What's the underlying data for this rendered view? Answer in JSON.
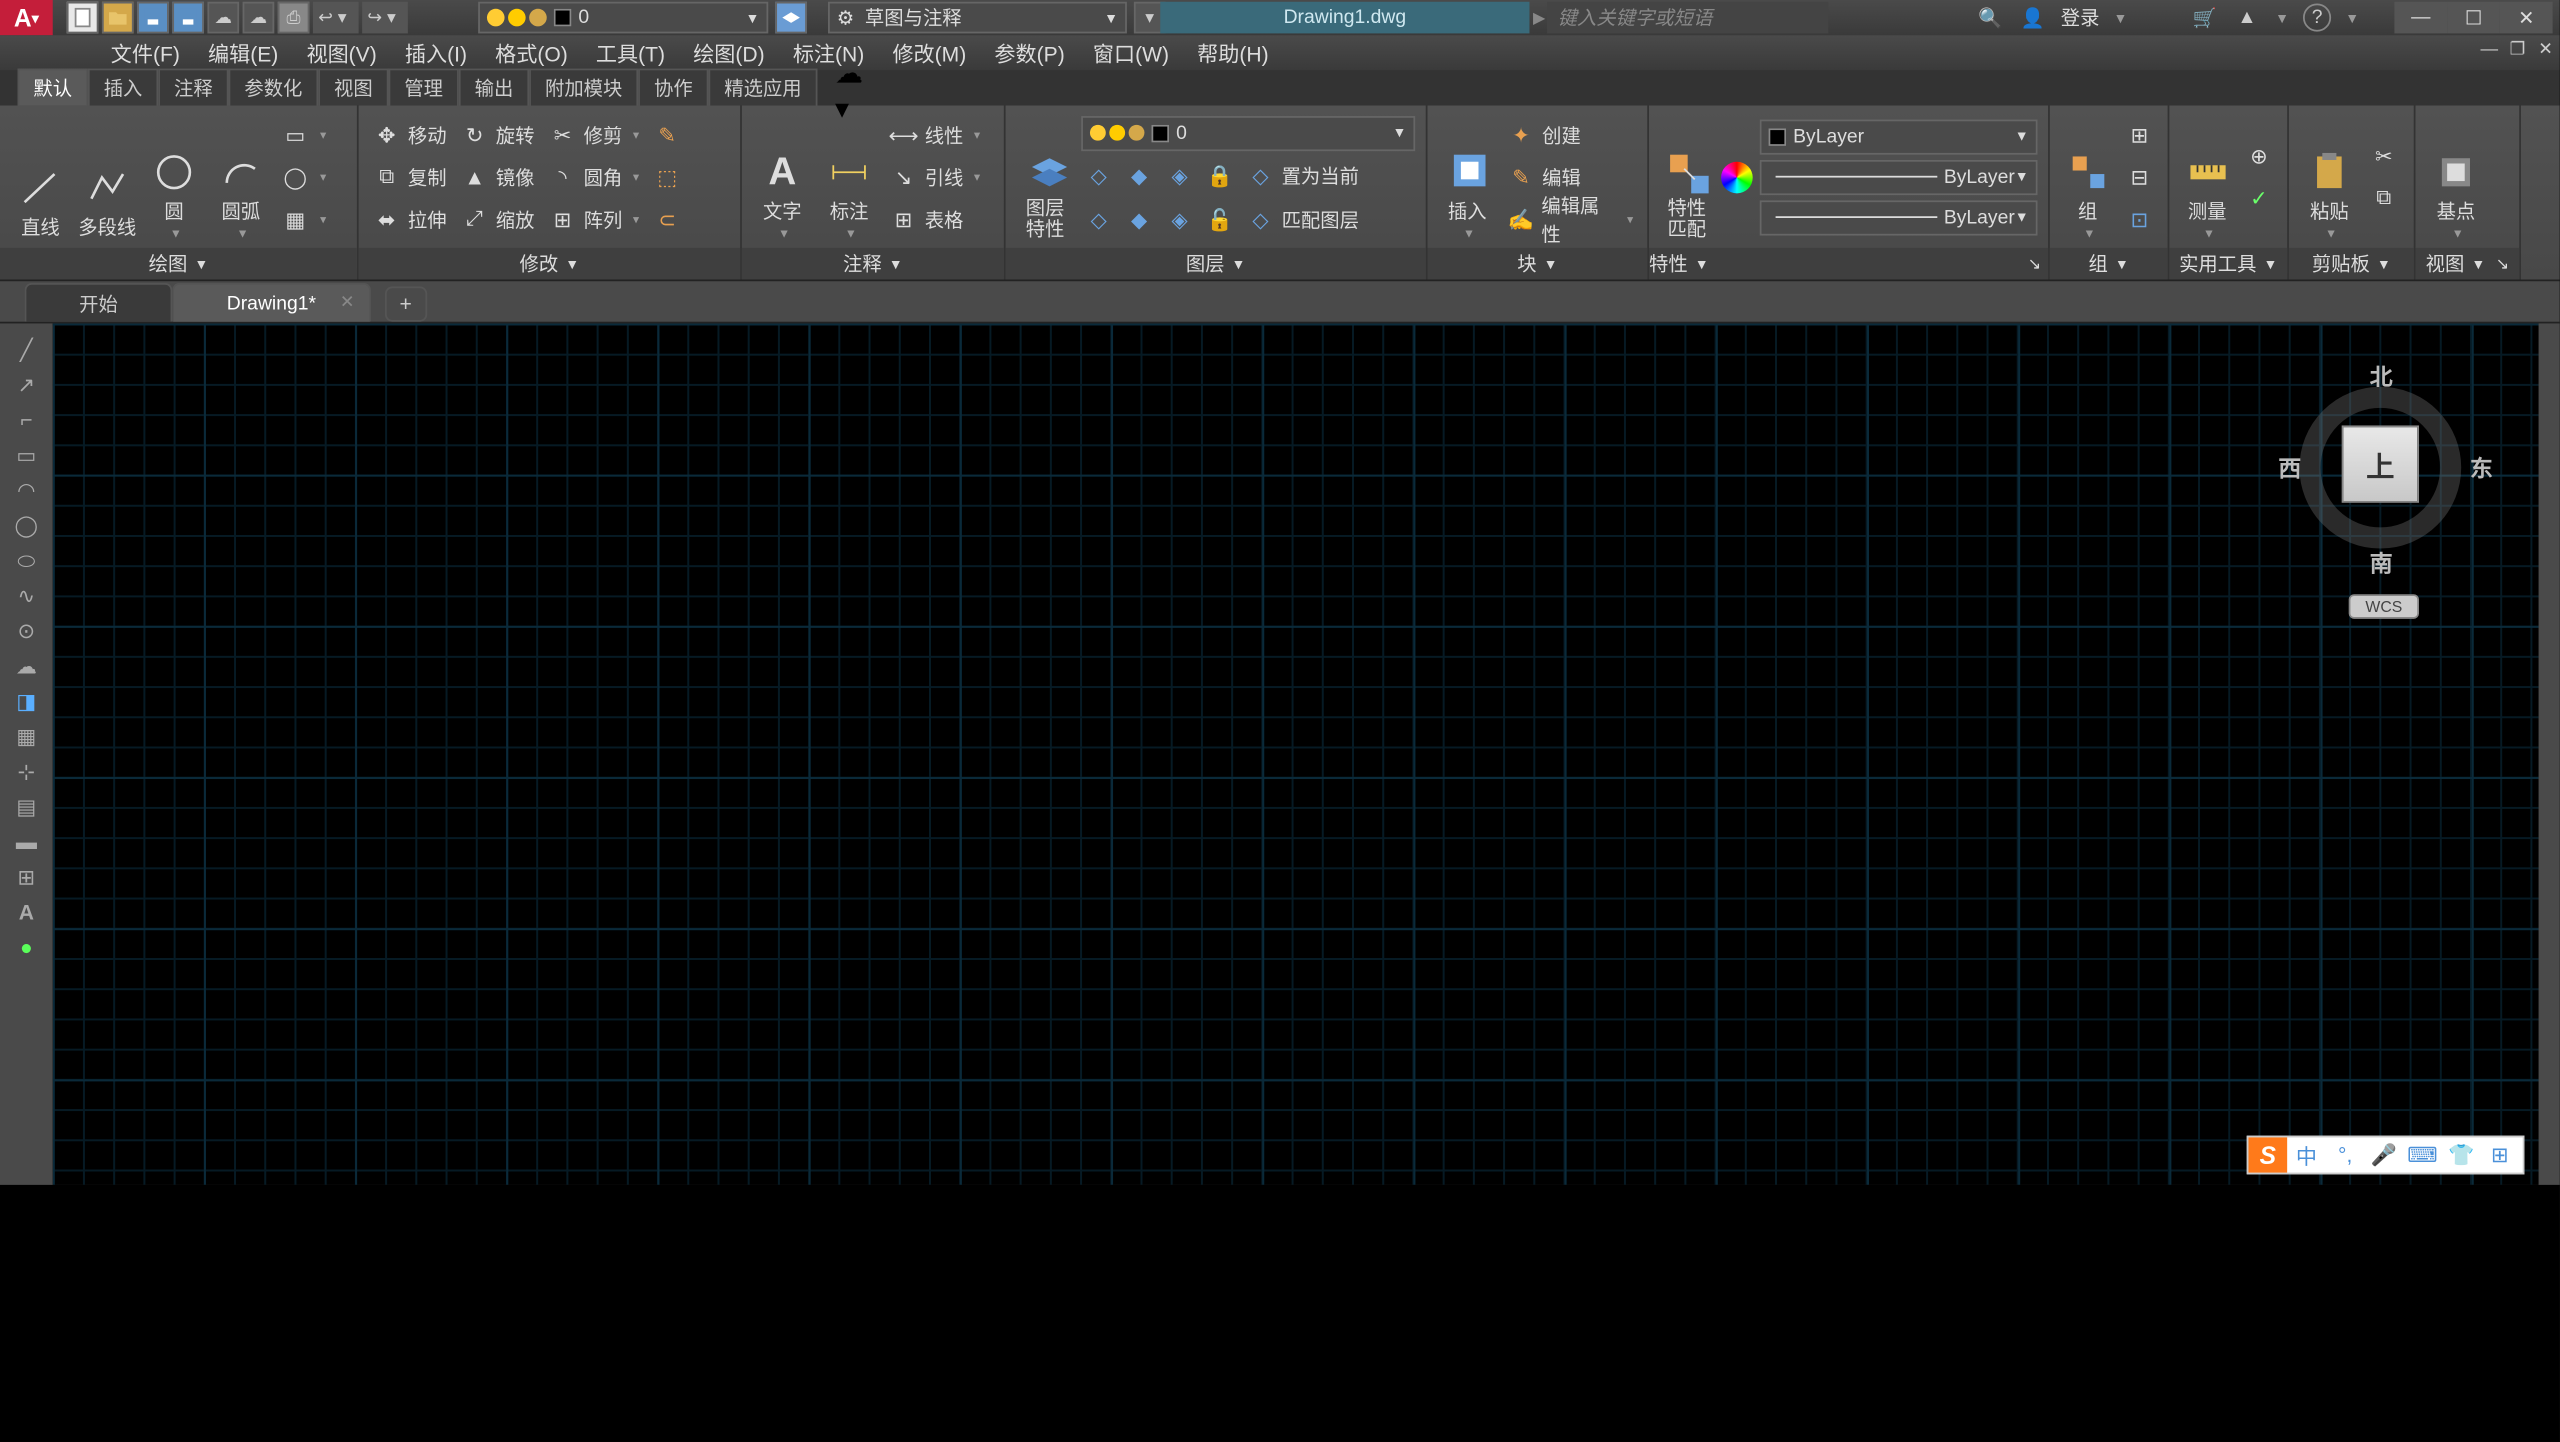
{
  "title": "Drawing1.dwg",
  "app_icon_letter": "A",
  "search_placeholder": "键入关键字或短语",
  "login_label": "登录",
  "layer_dropdown": {
    "value": "0"
  },
  "workspace_dropdown": {
    "value": "草图与注释"
  },
  "menubar": [
    "文件(F)",
    "编辑(E)",
    "视图(V)",
    "插入(I)",
    "格式(O)",
    "工具(T)",
    "绘图(D)",
    "标注(N)",
    "修改(M)",
    "参数(P)",
    "窗口(W)",
    "帮助(H)"
  ],
  "ribbon_tabs": [
    "默认",
    "插入",
    "注释",
    "参数化",
    "视图",
    "管理",
    "输出",
    "附加模块",
    "协作",
    "精选应用"
  ],
  "panels": {
    "draw": {
      "title": "绘图",
      "line": "直线",
      "polyline": "多段线",
      "circle": "圆",
      "arc": "圆弧"
    },
    "modify": {
      "title": "修改",
      "move": "移动",
      "copy": "复制",
      "stretch": "拉伸",
      "rotate": "旋转",
      "mirror": "镜像",
      "scale": "缩放",
      "trim": "修剪",
      "fillet": "圆角",
      "array": "阵列"
    },
    "annot": {
      "title": "注释",
      "text": "文字",
      "dim": "标注",
      "linear": "线性",
      "leader": "引线",
      "table": "表格"
    },
    "layers": {
      "title": "图层",
      "props": "图层\n特性",
      "dd_value": "0",
      "set_current": "置为当前",
      "match": "匹配图层"
    },
    "block": {
      "title": "块",
      "insert": "插入",
      "create": "创建",
      "edit": "编辑",
      "edit_attr": "编辑属性"
    },
    "props": {
      "title": "特性",
      "match": "特性\n匹配",
      "bylayer": "ByLayer"
    },
    "group": {
      "title": "组",
      "label": "组"
    },
    "utils": {
      "title": "实用工具",
      "measure": "测量"
    },
    "clip": {
      "title": "剪贴板",
      "paste": "粘贴"
    },
    "view": {
      "title": "视图",
      "base": "基点"
    }
  },
  "doc_tabs": {
    "start": "开始",
    "active": "Drawing1*"
  },
  "viewcube": {
    "top": "上",
    "n": "北",
    "s": "南",
    "w": "西",
    "e": "东",
    "wcs": "WCS"
  },
  "ime": {
    "logo": "S",
    "lang": "中"
  }
}
